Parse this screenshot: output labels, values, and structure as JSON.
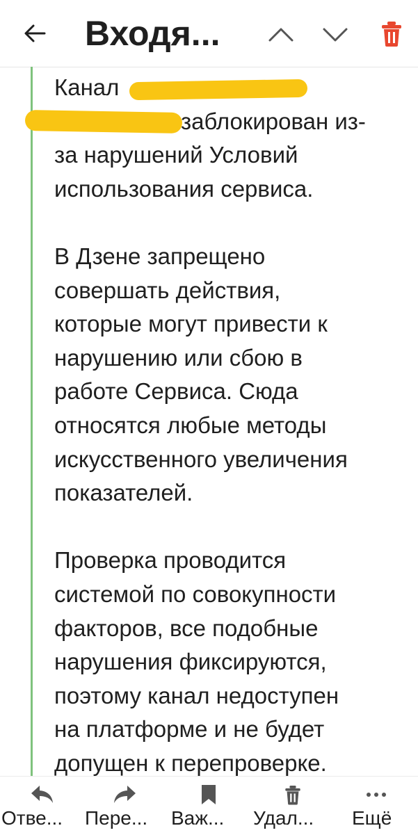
{
  "header": {
    "title": "Входя...",
    "icons": [
      "back-arrow-icon",
      "chevron-up-icon",
      "chevron-down-icon",
      "trash-icon"
    ],
    "accent_color": "#e8472f"
  },
  "message": {
    "quote_color": "#7fc27d",
    "redaction_color": "#f9c513",
    "paragraphs": [
      [
        "Канал",
        "заблокирован из-",
        "за нарушений Условий",
        "использования сервиса."
      ],
      [
        "В Дзене запрещено",
        "совершать действия,",
        "которые могут привести к",
        "нарушению или сбою в",
        "работе Сервиса. Сюда",
        "относятся любые методы",
        "искусственного увеличения",
        "показателей."
      ],
      [
        "Проверка проводится",
        "системой по совокупности",
        "факторов, все подобные",
        "нарушения фиксируются,",
        "поэтому канал недоступен",
        "на платформе и не будет",
        "допущен к перепроверке."
      ]
    ]
  },
  "toolbar": {
    "reply": "Отве...",
    "forward": "Пере...",
    "important": "Важ...",
    "delete": "Удал...",
    "more": "Ещё"
  }
}
